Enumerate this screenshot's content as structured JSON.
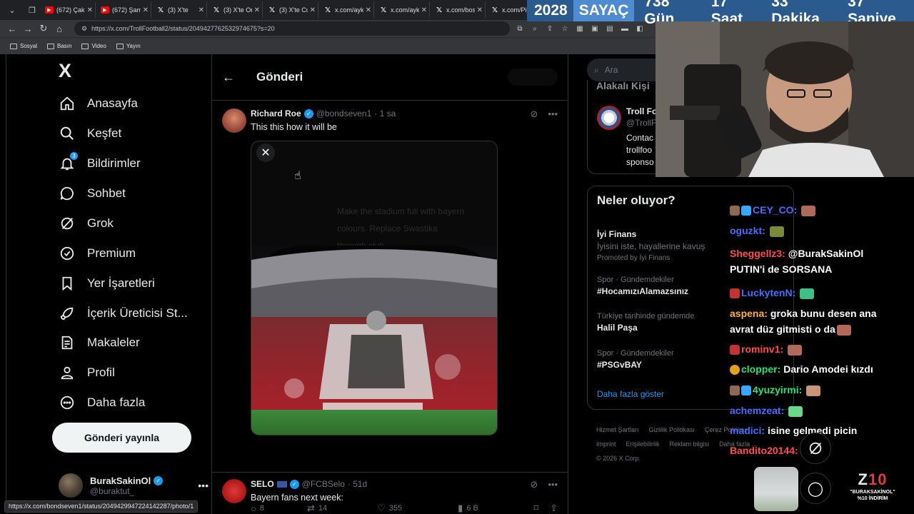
{
  "browser": {
    "tabs": [
      {
        "title": "(672) Çakı",
        "icon": "youtube-icon"
      },
      {
        "title": "(672) Şamp",
        "icon": "youtube-icon"
      },
      {
        "title": "(3) X'te",
        "icon": "x-icon"
      },
      {
        "title": "(3) X'te Or",
        "icon": "x-icon"
      },
      {
        "title": "(3) X'te Cu",
        "icon": "x-icon"
      },
      {
        "title": "x.com/ayk",
        "icon": "x-icon"
      },
      {
        "title": "x.com/ayk",
        "icon": "x-icon"
      },
      {
        "title": "x.com/bos",
        "icon": "x-icon"
      },
      {
        "title": "x.com/Piy",
        "icon": "x-icon"
      }
    ],
    "url": "https://x.com/TrollFootball2/status/2049427762532974675?s=20",
    "bookmarks": [
      "Sosyal",
      "Basın",
      "Video",
      "Yayın"
    ],
    "status_url": "https://x.com/bondseven1/status/2049429947224142287/photo/1"
  },
  "countdown": {
    "year": "2028",
    "label": "SAYAÇ",
    "days": "738 Gün",
    "hours": "17 Saat",
    "minutes": "33 Dakika",
    "seconds": "37 Saniye"
  },
  "sidebar": {
    "logo": "X",
    "items": [
      {
        "label": "Anasayfa",
        "icon": "home-icon"
      },
      {
        "label": "Keşfet",
        "icon": "search-icon"
      },
      {
        "label": "Bildirimler",
        "icon": "bell-icon",
        "badge": "3"
      },
      {
        "label": "Sohbet",
        "icon": "chat-icon"
      },
      {
        "label": "Grok",
        "icon": "grok-icon"
      },
      {
        "label": "Premium",
        "icon": "premium-icon"
      },
      {
        "label": "Yer İşaretleri",
        "icon": "bookmark-icon"
      },
      {
        "label": "İçerik Üreticisi St...",
        "icon": "rocket-icon"
      },
      {
        "label": "Makaleler",
        "icon": "article-icon"
      },
      {
        "label": "Profil",
        "icon": "profile-icon"
      },
      {
        "label": "Daha fazla",
        "icon": "more-circle-icon"
      }
    ],
    "post_button": "Gönderi yayınla",
    "account": {
      "name": "BurakSakinOl",
      "handle": "@buraktut_"
    }
  },
  "main": {
    "title": "Gönderi",
    "tweet": {
      "name": "Richard Roe",
      "handle": "@bondseven1",
      "time": "· 1 sa",
      "text": "This this how it will be",
      "media_overlay_text": "Make the stadium full with bayern colours. Replace Swastika through club",
      "replies": "8",
      "reposts": "14",
      "likes": "355",
      "views": "6 B"
    },
    "tweet2": {
      "name": "SELO",
      "handle": "@FCBSelo",
      "time": "· 51d",
      "text": "Bayern fans next week:"
    }
  },
  "right": {
    "search_placeholder": "Ara",
    "related_header": "Alakalı Kişi",
    "related": {
      "name": "Troll Fo",
      "handle": "@TrollF",
      "bio": [
        "Contac",
        "trollfoo",
        "sponso"
      ]
    },
    "trends_title": "Neler oluyor?",
    "promo": {
      "name": "İyi Finans",
      "desc": "İyisini iste, hayallerine kavuş",
      "promoted": "Promoted by İyi Finans"
    },
    "trends": [
      {
        "context": "Spor · Gündemdekiler",
        "topic": "#HocamızıAlamazsınız"
      },
      {
        "context": "Türkiye tarihinde gündemde",
        "topic": "Halil Paşa"
      },
      {
        "context": "Spor · Gündemdekiler",
        "topic": "#PSGvBAY"
      }
    ],
    "show_more": "Daha fazla göster",
    "footer": [
      "Hizmet Şartları",
      "Gizlilik Politikası",
      "Çerez Politikası",
      "Imprint",
      "Erişilebilirlik",
      "Reklam bilgisi",
      "Daha fazla ...",
      "© 2026 X Corp."
    ]
  },
  "chat": [
    {
      "user": "CEY_CO:",
      "text": "",
      "color": "#4b6cff"
    },
    {
      "user": "oguzkt:",
      "text": "",
      "color": "#4b6cff"
    },
    {
      "user": "Sheggellz3:",
      "text": "@BurakSakinOl",
      "text2": "PUTIN'i de SORSANA",
      "color": "#ff4f4f"
    },
    {
      "user": "LuckytenN:",
      "text": "",
      "color": "#4b6cff"
    },
    {
      "user": "aspena:",
      "text": "groka bunu desen ana",
      "text2": "avrat düz gitmisti o da",
      "color": "#ffb13b"
    },
    {
      "user": "rominv1:",
      "text": "",
      "color": "#ff4f4f"
    },
    {
      "user": "clopper:",
      "text": "Dario Amodei kızdı",
      "color": "#2ee07a"
    },
    {
      "user": "4yuzyirmi:",
      "text": "",
      "color": "#2ee07a"
    },
    {
      "user": "achemzeat:",
      "text": "",
      "color": "#4b6cff"
    },
    {
      "user": "madici:",
      "text": "isine gelmedi picin",
      "color": "#4b6cff"
    },
    {
      "user": "Bandito20144:",
      "text": "",
      "color": "#ff4f4f"
    }
  ],
  "sponsor": {
    "brand_a": "Z",
    "brand_b": "10",
    "line1": "\"BURAKSAKİNOL\"",
    "line2": "%10 İNDİRİM"
  },
  "colors": {
    "accent": "#1d9bf0",
    "countdown_bg": "#2b5a8f",
    "countdown_label_bg": "#4f8bd1"
  }
}
